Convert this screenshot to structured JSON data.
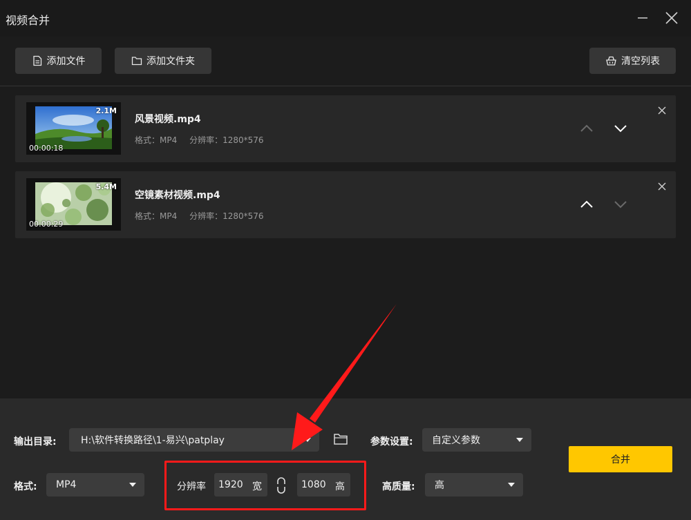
{
  "window": {
    "title": "视频合并"
  },
  "toolbar": {
    "add_file_label": "添加文件",
    "add_folder_label": "添加文件夹",
    "clear_list_label": "清空列表"
  },
  "files": [
    {
      "name": "风景视频.mp4",
      "size": "2.1M",
      "duration": "00:00:18",
      "format_label": "格式：MP4",
      "resolution_label": "分辨率：1280*576"
    },
    {
      "name": "空镜素材视频.mp4",
      "size": "5.4M",
      "duration": "00:00:29",
      "format_label": "格式：MP4",
      "resolution_label": "分辨率：1280*576"
    }
  ],
  "settings": {
    "output_dir_label": "输出目录:",
    "output_dir_value": "H:\\软件转换路径\\1-易兴\\patplay",
    "params_label": "参数设置:",
    "params_value": "自定义参数",
    "format_label": "格式:",
    "format_value": "MP4",
    "resolution_label": "分辨率",
    "width_value": "1920",
    "width_unit": "宽",
    "height_value": "1080",
    "height_unit": "高",
    "quality_label": "高质量:",
    "quality_value": "高",
    "merge_label": "合并"
  },
  "colors": {
    "accent": "#ffc700",
    "annotation": "#ff1a1a"
  }
}
